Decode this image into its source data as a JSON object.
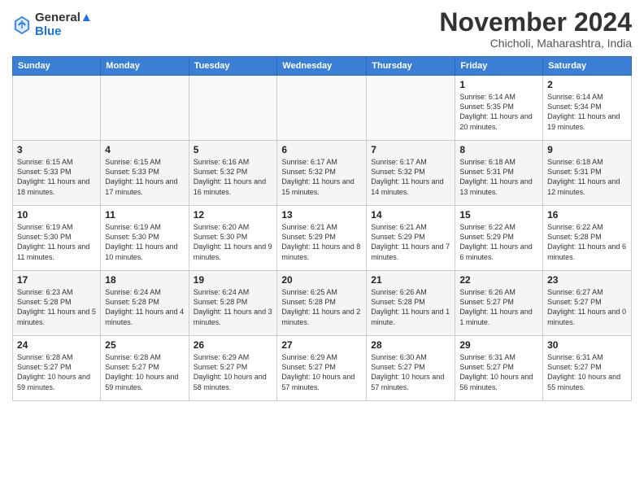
{
  "logo": {
    "line1": "General",
    "line2": "Blue"
  },
  "title": "November 2024",
  "subtitle": "Chicholi, Maharashtra, India",
  "weekdays": [
    "Sunday",
    "Monday",
    "Tuesday",
    "Wednesday",
    "Thursday",
    "Friday",
    "Saturday"
  ],
  "weeks": [
    [
      {
        "day": "",
        "info": ""
      },
      {
        "day": "",
        "info": ""
      },
      {
        "day": "",
        "info": ""
      },
      {
        "day": "",
        "info": ""
      },
      {
        "day": "",
        "info": ""
      },
      {
        "day": "1",
        "info": "Sunrise: 6:14 AM\nSunset: 5:35 PM\nDaylight: 11 hours and 20 minutes."
      },
      {
        "day": "2",
        "info": "Sunrise: 6:14 AM\nSunset: 5:34 PM\nDaylight: 11 hours and 19 minutes."
      }
    ],
    [
      {
        "day": "3",
        "info": "Sunrise: 6:15 AM\nSunset: 5:33 PM\nDaylight: 11 hours and 18 minutes."
      },
      {
        "day": "4",
        "info": "Sunrise: 6:15 AM\nSunset: 5:33 PM\nDaylight: 11 hours and 17 minutes."
      },
      {
        "day": "5",
        "info": "Sunrise: 6:16 AM\nSunset: 5:32 PM\nDaylight: 11 hours and 16 minutes."
      },
      {
        "day": "6",
        "info": "Sunrise: 6:17 AM\nSunset: 5:32 PM\nDaylight: 11 hours and 15 minutes."
      },
      {
        "day": "7",
        "info": "Sunrise: 6:17 AM\nSunset: 5:32 PM\nDaylight: 11 hours and 14 minutes."
      },
      {
        "day": "8",
        "info": "Sunrise: 6:18 AM\nSunset: 5:31 PM\nDaylight: 11 hours and 13 minutes."
      },
      {
        "day": "9",
        "info": "Sunrise: 6:18 AM\nSunset: 5:31 PM\nDaylight: 11 hours and 12 minutes."
      }
    ],
    [
      {
        "day": "10",
        "info": "Sunrise: 6:19 AM\nSunset: 5:30 PM\nDaylight: 11 hours and 11 minutes."
      },
      {
        "day": "11",
        "info": "Sunrise: 6:19 AM\nSunset: 5:30 PM\nDaylight: 11 hours and 10 minutes."
      },
      {
        "day": "12",
        "info": "Sunrise: 6:20 AM\nSunset: 5:30 PM\nDaylight: 11 hours and 9 minutes."
      },
      {
        "day": "13",
        "info": "Sunrise: 6:21 AM\nSunset: 5:29 PM\nDaylight: 11 hours and 8 minutes."
      },
      {
        "day": "14",
        "info": "Sunrise: 6:21 AM\nSunset: 5:29 PM\nDaylight: 11 hours and 7 minutes."
      },
      {
        "day": "15",
        "info": "Sunrise: 6:22 AM\nSunset: 5:29 PM\nDaylight: 11 hours and 6 minutes."
      },
      {
        "day": "16",
        "info": "Sunrise: 6:22 AM\nSunset: 5:28 PM\nDaylight: 11 hours and 6 minutes."
      }
    ],
    [
      {
        "day": "17",
        "info": "Sunrise: 6:23 AM\nSunset: 5:28 PM\nDaylight: 11 hours and 5 minutes."
      },
      {
        "day": "18",
        "info": "Sunrise: 6:24 AM\nSunset: 5:28 PM\nDaylight: 11 hours and 4 minutes."
      },
      {
        "day": "19",
        "info": "Sunrise: 6:24 AM\nSunset: 5:28 PM\nDaylight: 11 hours and 3 minutes."
      },
      {
        "day": "20",
        "info": "Sunrise: 6:25 AM\nSunset: 5:28 PM\nDaylight: 11 hours and 2 minutes."
      },
      {
        "day": "21",
        "info": "Sunrise: 6:26 AM\nSunset: 5:28 PM\nDaylight: 11 hours and 1 minute."
      },
      {
        "day": "22",
        "info": "Sunrise: 6:26 AM\nSunset: 5:27 PM\nDaylight: 11 hours and 1 minute."
      },
      {
        "day": "23",
        "info": "Sunrise: 6:27 AM\nSunset: 5:27 PM\nDaylight: 11 hours and 0 minutes."
      }
    ],
    [
      {
        "day": "24",
        "info": "Sunrise: 6:28 AM\nSunset: 5:27 PM\nDaylight: 10 hours and 59 minutes."
      },
      {
        "day": "25",
        "info": "Sunrise: 6:28 AM\nSunset: 5:27 PM\nDaylight: 10 hours and 59 minutes."
      },
      {
        "day": "26",
        "info": "Sunrise: 6:29 AM\nSunset: 5:27 PM\nDaylight: 10 hours and 58 minutes."
      },
      {
        "day": "27",
        "info": "Sunrise: 6:29 AM\nSunset: 5:27 PM\nDaylight: 10 hours and 57 minutes."
      },
      {
        "day": "28",
        "info": "Sunrise: 6:30 AM\nSunset: 5:27 PM\nDaylight: 10 hours and 57 minutes."
      },
      {
        "day": "29",
        "info": "Sunrise: 6:31 AM\nSunset: 5:27 PM\nDaylight: 10 hours and 56 minutes."
      },
      {
        "day": "30",
        "info": "Sunrise: 6:31 AM\nSunset: 5:27 PM\nDaylight: 10 hours and 55 minutes."
      }
    ]
  ]
}
